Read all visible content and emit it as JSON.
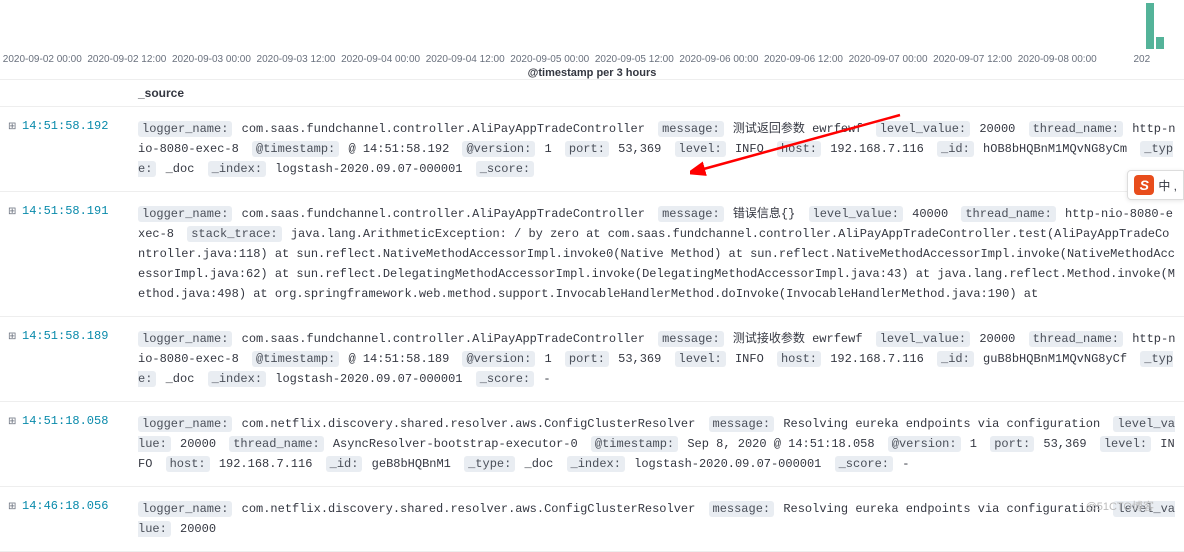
{
  "chart": {
    "xlabel": "@timestamp per 3 hours",
    "ticks": [
      "2020-09-02 00:00",
      "2020-09-02 12:00",
      "2020-09-03 00:00",
      "2020-09-03 12:00",
      "2020-09-04 00:00",
      "2020-09-04 12:00",
      "2020-09-05 00:00",
      "2020-09-05 12:00",
      "2020-09-06 00:00",
      "2020-09-06 12:00",
      "2020-09-07 00:00",
      "2020-09-07 12:00",
      "2020-09-08 00:00",
      "202"
    ]
  },
  "header": {
    "time": "",
    "source": "_source"
  },
  "rows": [
    {
      "time": "14:51:58.192",
      "fields": [
        {
          "k": "logger_name:",
          "v": "com.saas.fundchannel.controller.AliPayAppTradeController"
        },
        {
          "k": "message:",
          "v": "测试返回参数 ewrfewf"
        },
        {
          "k": "level_value:",
          "v": "20000"
        },
        {
          "k": "thread_name:",
          "v": "http-nio-8080-exec-8"
        },
        {
          "k": "@timestamp:",
          "v": "@ 14:51:58.192"
        },
        {
          "k": "@version:",
          "v": "1"
        },
        {
          "k": "port:",
          "v": "53,369"
        },
        {
          "k": "level:",
          "v": "INFO"
        },
        {
          "k": "host:",
          "v": "192.168.7.116"
        },
        {
          "k": "_id:",
          "v": "hOB8bHQBnM1MQvNG8yCm"
        },
        {
          "k": "_type:",
          "v": "_doc"
        },
        {
          "k": "_index:",
          "v": "logstash-2020.09.07-000001"
        },
        {
          "k": "_score:",
          "v": ""
        }
      ]
    },
    {
      "time": "14:51:58.191",
      "fields": [
        {
          "k": "logger_name:",
          "v": "com.saas.fundchannel.controller.AliPayAppTradeController"
        },
        {
          "k": "message:",
          "v": "错误信息{}"
        },
        {
          "k": "level_value:",
          "v": "40000"
        },
        {
          "k": "thread_name:",
          "v": "http-nio-8080-exec-8"
        },
        {
          "k": "stack_trace:",
          "v": "java.lang.ArithmeticException: / by zero at com.saas.fundchannel.controller.AliPayAppTradeController.test(AliPayAppTradeController.java:118) at sun.reflect.NativeMethodAccessorImpl.invoke0(Native Method) at sun.reflect.NativeMethodAccessorImpl.invoke(NativeMethodAccessorImpl.java:62) at sun.reflect.DelegatingMethodAccessorImpl.invoke(DelegatingMethodAccessorImpl.java:43) at java.lang.reflect.Method.invoke(Method.java:498) at org.springframework.web.method.support.InvocableHandlerMethod.doInvoke(InvocableHandlerMethod.java:190) at"
        }
      ]
    },
    {
      "time": "14:51:58.189",
      "fields": [
        {
          "k": "logger_name:",
          "v": "com.saas.fundchannel.controller.AliPayAppTradeController"
        },
        {
          "k": "message:",
          "v": "测试接收参数 ewrfewf"
        },
        {
          "k": "level_value:",
          "v": "20000"
        },
        {
          "k": "thread_name:",
          "v": "http-nio-8080-exec-8"
        },
        {
          "k": "@timestamp:",
          "v": "@ 14:51:58.189"
        },
        {
          "k": "@version:",
          "v": "1"
        },
        {
          "k": "port:",
          "v": "53,369"
        },
        {
          "k": "level:",
          "v": "INFO"
        },
        {
          "k": "host:",
          "v": "192.168.7.116"
        },
        {
          "k": "_id:",
          "v": "guB8bHQBnM1MQvNG8yCf"
        },
        {
          "k": "_type:",
          "v": "_doc"
        },
        {
          "k": "_index:",
          "v": "logstash-2020.09.07-000001"
        },
        {
          "k": "_score:",
          "v": "-"
        }
      ]
    },
    {
      "time": "14:51:18.058",
      "fields": [
        {
          "k": "logger_name:",
          "v": "com.netflix.discovery.shared.resolver.aws.ConfigClusterResolver"
        },
        {
          "k": "message:",
          "v": "Resolving eureka endpoints via configuration"
        },
        {
          "k": "level_value:",
          "v": "20000"
        },
        {
          "k": "thread_name:",
          "v": "AsyncResolver-bootstrap-executor-0"
        },
        {
          "k": "@timestamp:",
          "v": "Sep 8, 2020 @ 14:51:18.058"
        },
        {
          "k": "@version:",
          "v": "1"
        },
        {
          "k": "port:",
          "v": "53,369"
        },
        {
          "k": "level:",
          "v": "INFO"
        },
        {
          "k": "host:",
          "v": "192.168.7.116"
        },
        {
          "k": "_id:",
          "v": "geB8bHQBnM1"
        },
        {
          "k": "_type:",
          "v": "_doc"
        },
        {
          "k": "_index:",
          "v": "logstash-2020.09.07-000001"
        },
        {
          "k": "_score:",
          "v": "-"
        }
      ]
    },
    {
      "time": "14:46:18.056",
      "fields": [
        {
          "k": "logger_name:",
          "v": "com.netflix.discovery.shared.resolver.aws.ConfigClusterResolver"
        },
        {
          "k": "message:",
          "v": "Resolving eureka endpoints via configuration"
        },
        {
          "k": "level_value:",
          "v": "20000"
        }
      ]
    }
  ],
  "badge": {
    "letter": "S",
    "text": "中 ,"
  },
  "watermark": "@51CTO博客"
}
